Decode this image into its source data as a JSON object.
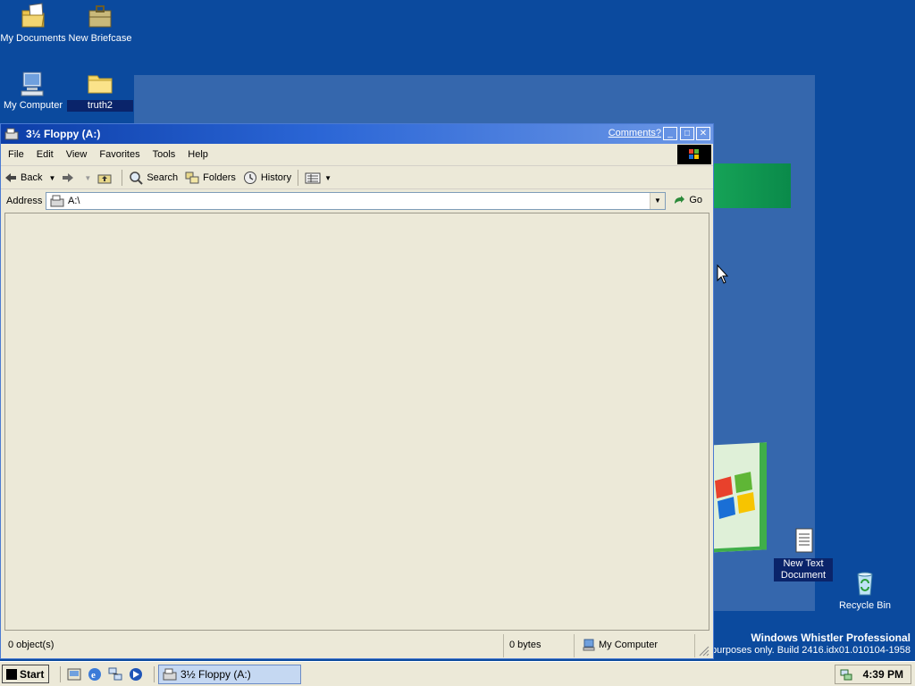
{
  "desktop": {
    "icons": [
      {
        "label": "My Documents",
        "icon": "my-documents-icon"
      },
      {
        "label": "New Briefcase",
        "icon": "briefcase-icon"
      },
      {
        "label": "My Computer",
        "icon": "computer-icon"
      },
      {
        "label": "truth2",
        "icon": "folder-icon"
      },
      {
        "label": "New Text Document",
        "icon": "text-document-icon"
      },
      {
        "label": "Recycle Bin",
        "icon": "recycle-bin-icon"
      }
    ],
    "branding": {
      "line1": "Windows Whistler Professional",
      "line2": "purposes only. Build 2416.idx01.010104-1958"
    },
    "background_color": "#0b4a9e"
  },
  "window": {
    "title": "3½ Floppy (A:)",
    "comments_link": "Comments?",
    "controls": {
      "minimize": "_",
      "maximize": "□",
      "close": "✕"
    },
    "menu": [
      "File",
      "Edit",
      "View",
      "Favorites",
      "Tools",
      "Help"
    ],
    "toolbar": {
      "back": "Back",
      "search": "Search",
      "folders": "Folders",
      "history": "History"
    },
    "address": {
      "label": "Address",
      "value": "A:\\",
      "go": "Go"
    },
    "status": {
      "objects": "0 object(s)",
      "size": "0 bytes",
      "zone": "My Computer"
    }
  },
  "taskbar": {
    "start": "Start",
    "task_label": "3½ Floppy (A:)",
    "clock": "4:39 PM"
  }
}
